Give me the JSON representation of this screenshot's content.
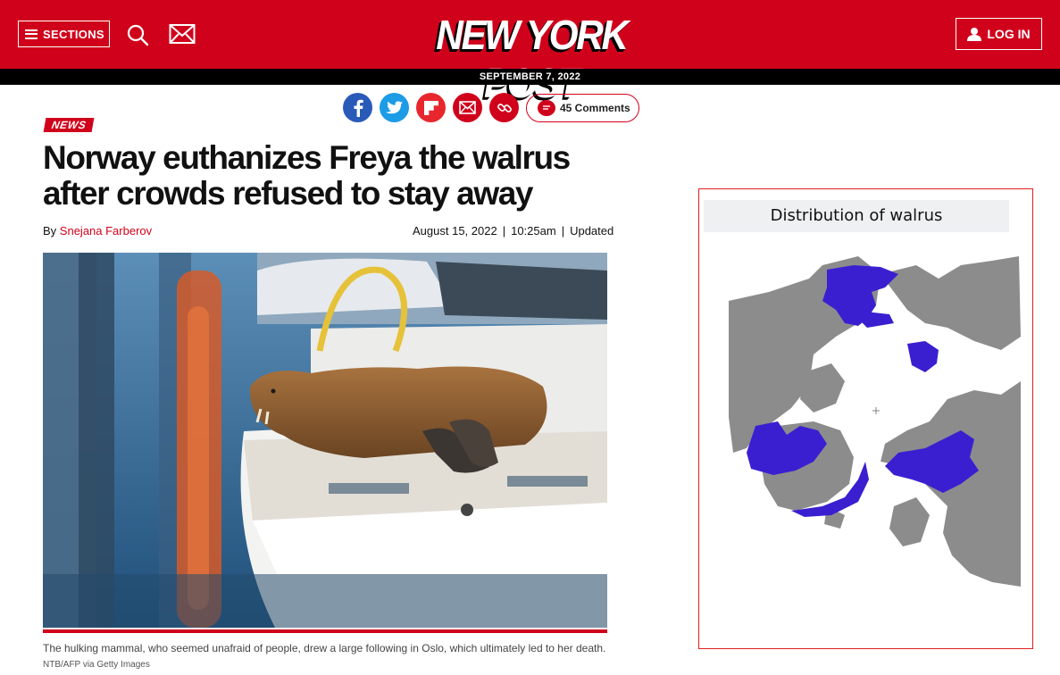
{
  "header": {
    "sections_label": "SECTIONS",
    "logo_text": "NEW YORK POST",
    "login_label": "LOG IN",
    "date": "SEPTEMBER 7, 2022"
  },
  "share": {
    "items": [
      "facebook-icon",
      "twitter-icon",
      "flipboard-icon",
      "email-icon",
      "link-icon"
    ],
    "comments_label": "45 Comments"
  },
  "article": {
    "kicker": "NEWS",
    "headline": "Norway euthanizes Freya the walrus after crowds refused to stay away",
    "byline_prefix": "By",
    "author": "Snejana Farberov",
    "date": "August 15, 2022",
    "time": "10:25am",
    "updated_label": "Updated",
    "caption": "The hulking mammal, who seemed unafraid of people, drew a large following in Oslo, which ultimately led to her death.",
    "credit": "NTB/AFP via Getty Images"
  },
  "map": {
    "title": "Distribution of walrus",
    "land_color": "#8c8c8c",
    "range_color": "#3a1fd1"
  },
  "colors": {
    "brand_red": "#d0021b",
    "black": "#000000"
  }
}
